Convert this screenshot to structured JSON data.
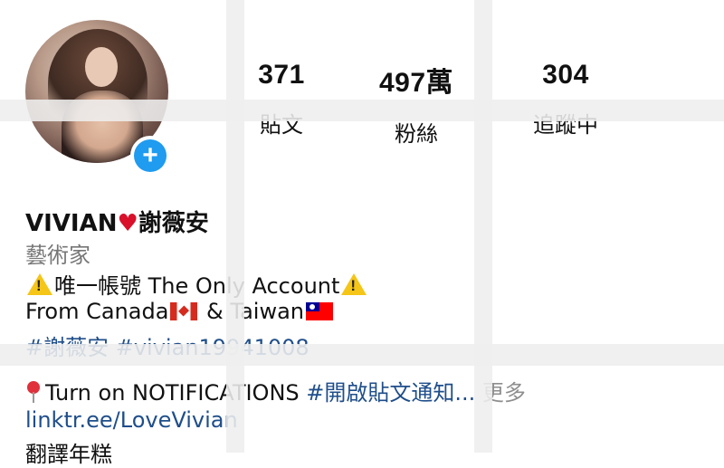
{
  "profile": {
    "name": "VIVIAN",
    "name_suffix": "謝薇安",
    "category": "藝術家",
    "follow_button": "+"
  },
  "stats": [
    {
      "value": "371",
      "label": "貼文"
    },
    {
      "value": "497萬",
      "label": "粉絲"
    },
    {
      "value": "304",
      "label": "追蹤中"
    }
  ],
  "bio": {
    "line1": "唯一帳號 The Only Account",
    "line2_part1": "From Canada",
    "line2_part2": " & ",
    "line2_part3": "Taiwan",
    "hashtags": "#謝薇安 #vivian19941008",
    "notif_text": "Turn on NOTIFICATIONS ",
    "notif_hashtag": "#開啟貼文通知...",
    "more": " 更多",
    "link": "linktr.ee/LoveVivian",
    "translate": "翻譯年糕"
  },
  "colors": {
    "link": "#1f4e8a",
    "accent_blue": "#1f9bf0",
    "muted": "#777777"
  }
}
